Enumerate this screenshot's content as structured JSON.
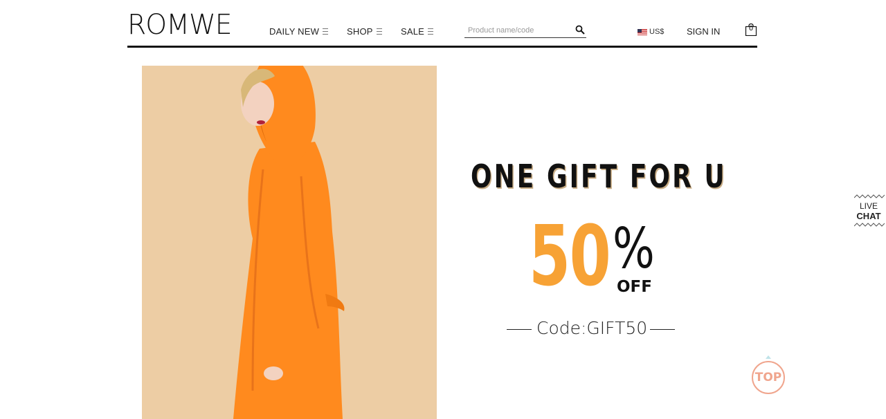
{
  "header": {
    "logo": "ROMWE",
    "nav": [
      {
        "label": "DAILY NEW"
      },
      {
        "label": "SHOP"
      },
      {
        "label": "SALE"
      }
    ],
    "search": {
      "placeholder": "Product name/code"
    },
    "currency": "US$",
    "sign_in": "SIGN IN",
    "bag_count": "0"
  },
  "hero": {
    "headline": "ONE GIFT FOR U",
    "discount_number": "50",
    "percent_sign": "%",
    "off_label": "OFF",
    "code": "Code:GIFT50",
    "accent_color": "#f7a235",
    "photo_bg_color": "#edcda4",
    "coat_color": "#ff8a1e"
  },
  "widgets": {
    "live_chat_line1": "LIVE",
    "live_chat_line2": "CHAT",
    "top_label": "TOP",
    "top_color": "#f0a58d"
  }
}
